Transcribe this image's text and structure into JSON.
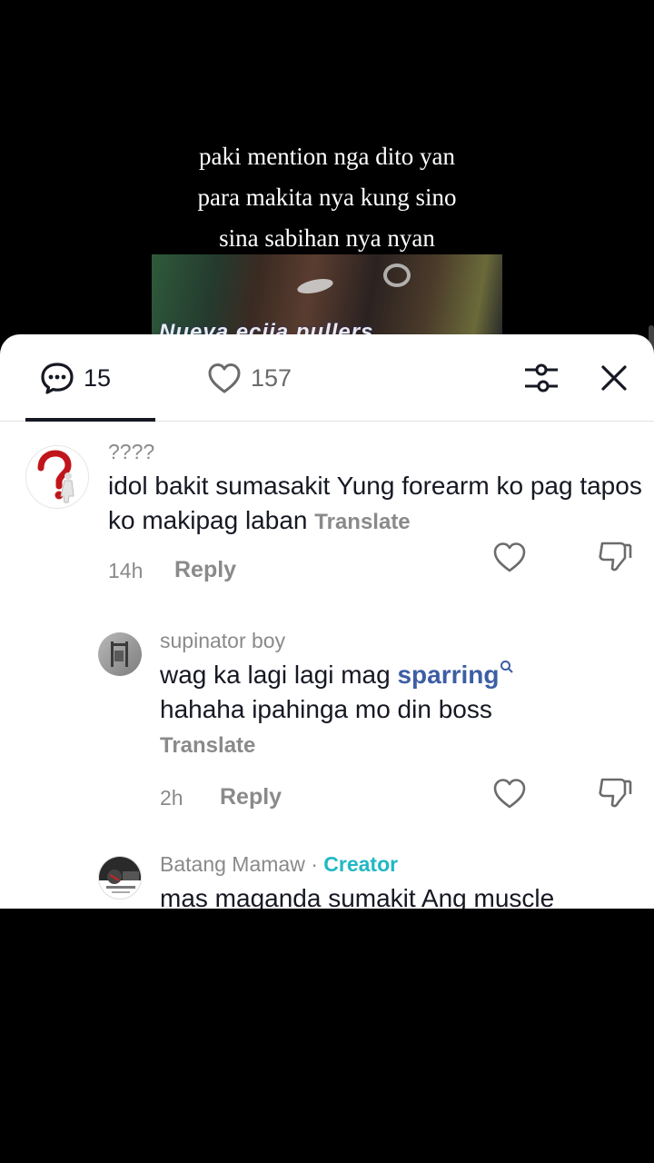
{
  "video": {
    "caption_lines": [
      "paki mention nga dito yan",
      "para makita nya kung sino",
      "sina sabihan nya nyan"
    ],
    "overlay_text": "Nueva ecija pullers"
  },
  "sheet": {
    "tabs": {
      "comments_count": "15",
      "likes_count": "157"
    }
  },
  "comments": [
    {
      "username": "????",
      "text": "idol bakit sumasakit Yung forearm ko pag tapos ko makipag laban",
      "translate": "Translate",
      "time": "14h",
      "reply": "Reply"
    },
    {
      "username": "supinator boy",
      "text_before": "wag ka lagi lagi mag ",
      "link": "sparring",
      "text_after": "hahaha ipahinga mo din boss",
      "translate": "Translate",
      "time": "2h",
      "reply": "Reply"
    },
    {
      "username": "Batang Mamaw",
      "separator": " · ",
      "badge": "Creator",
      "text": "mas maganda sumakit Ang muscle"
    }
  ],
  "colors": {
    "accent_link": "#3d5ea6",
    "creator_badge": "#20b8c4",
    "muted_text": "#8a8a8a",
    "primary_text": "#161823"
  },
  "icons": {
    "comments_tab": "comment-bubble-icon",
    "likes_tab": "heart-outline-icon",
    "filter": "sliders-icon",
    "close": "close-icon",
    "like": "heart-outline-icon",
    "dislike": "thumbs-down-icon",
    "search_hint": "search-icon"
  }
}
